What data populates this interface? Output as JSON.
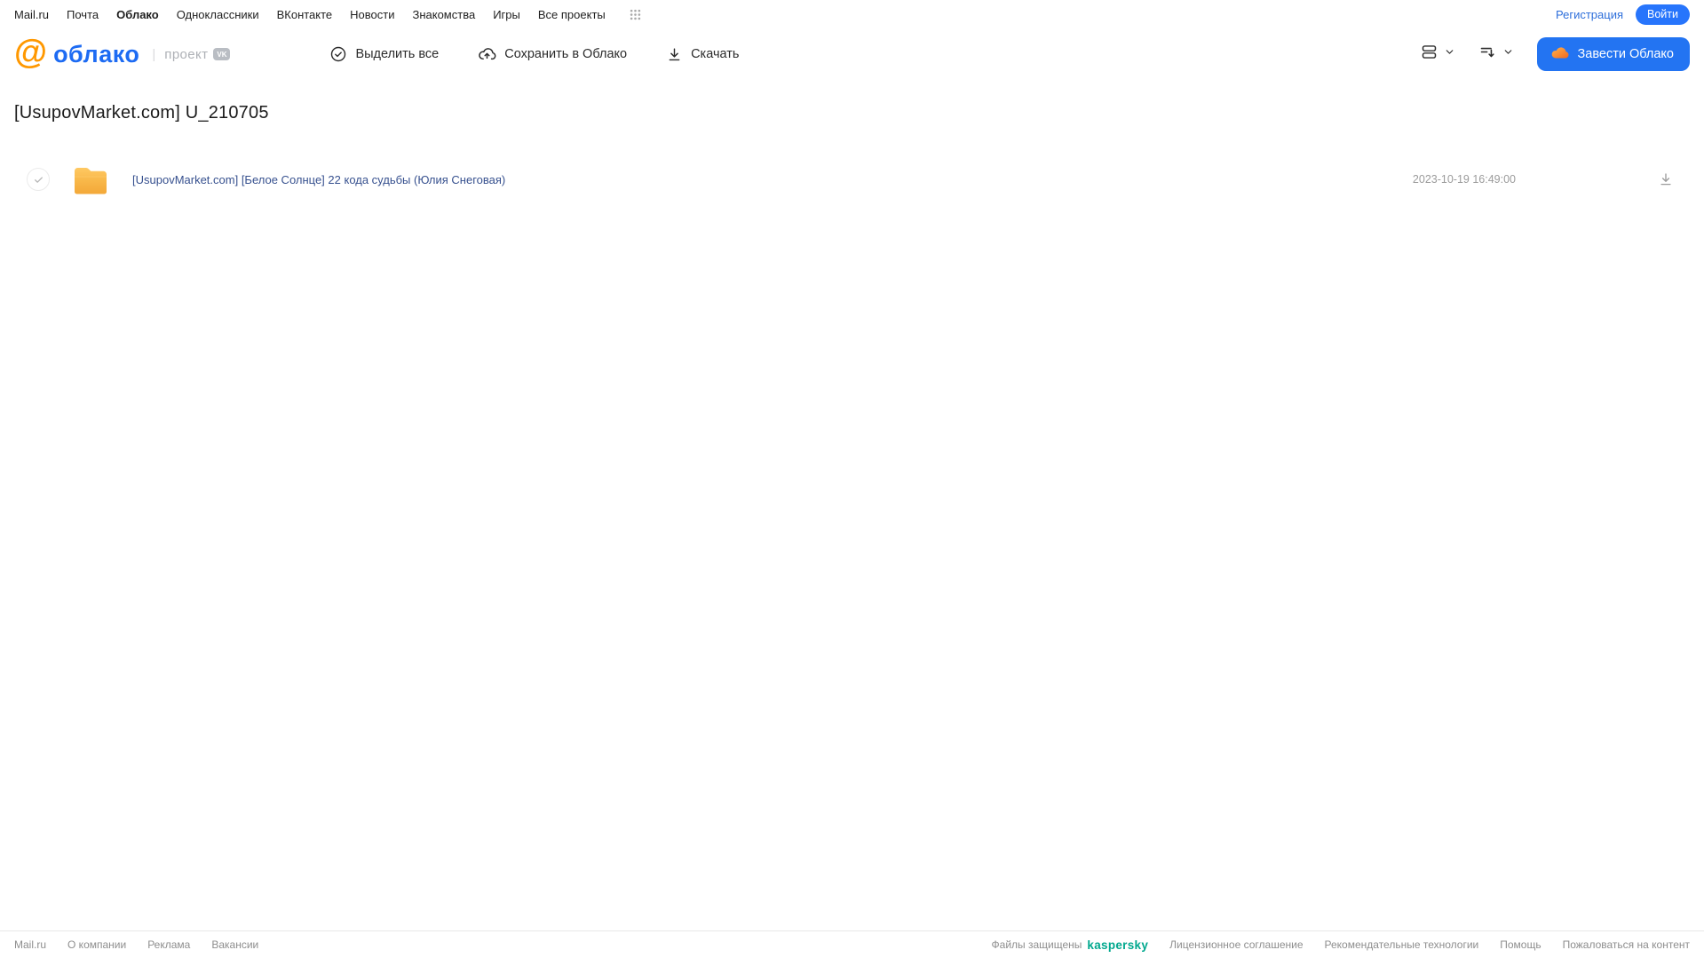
{
  "topnav": {
    "items": [
      {
        "label": "Mail.ru",
        "active": false
      },
      {
        "label": "Почта",
        "active": false
      },
      {
        "label": "Облако",
        "active": true
      },
      {
        "label": "Одноклассники",
        "active": false
      },
      {
        "label": "ВКонтакте",
        "active": false
      },
      {
        "label": "Новости",
        "active": false
      },
      {
        "label": "Знакомства",
        "active": false
      },
      {
        "label": "Игры",
        "active": false
      },
      {
        "label": "Все проекты",
        "active": false
      }
    ],
    "register_label": "Регистрация",
    "login_label": "Войти"
  },
  "header": {
    "logo_at": "@",
    "logo_text": "облако",
    "project_label": "проект",
    "vk_badge": "VK",
    "toolbar": {
      "select_all_label": "Выделить все",
      "save_to_cloud_label": "Сохранить в Облако",
      "download_label": "Скачать"
    },
    "cta_label": "Завести Облако"
  },
  "main": {
    "title": "[UsupovMarket.com] U_210705",
    "files": [
      {
        "type": "folder",
        "name": "[UsupovMarket.com] [Белое Солнце] 22 кода судьбы (Юлия Снеговая)",
        "date": "2023-10-19 16:49:00"
      }
    ]
  },
  "footer": {
    "left_links": [
      "Mail.ru",
      "О компании",
      "Реклама",
      "Вакансии"
    ],
    "protected_label": "Файлы защищены",
    "kaspersky_label": "kaspersky",
    "right_links": [
      "Лицензионное соглашение",
      "Рекомендательные технологии",
      "Помощь",
      "Пожаловаться на контент"
    ]
  },
  "colors": {
    "accent_blue": "#2374f2",
    "logo_blue": "#1d6bf3",
    "logo_orange": "#ff9800",
    "link_blue": "#2e6fdb",
    "file_link": "#37518f",
    "folder_yellow_light": "#ffc963",
    "folder_yellow": "#f5a93b",
    "kaspersky_teal": "#00a88e",
    "muted_gray": "#9b9b9b"
  }
}
